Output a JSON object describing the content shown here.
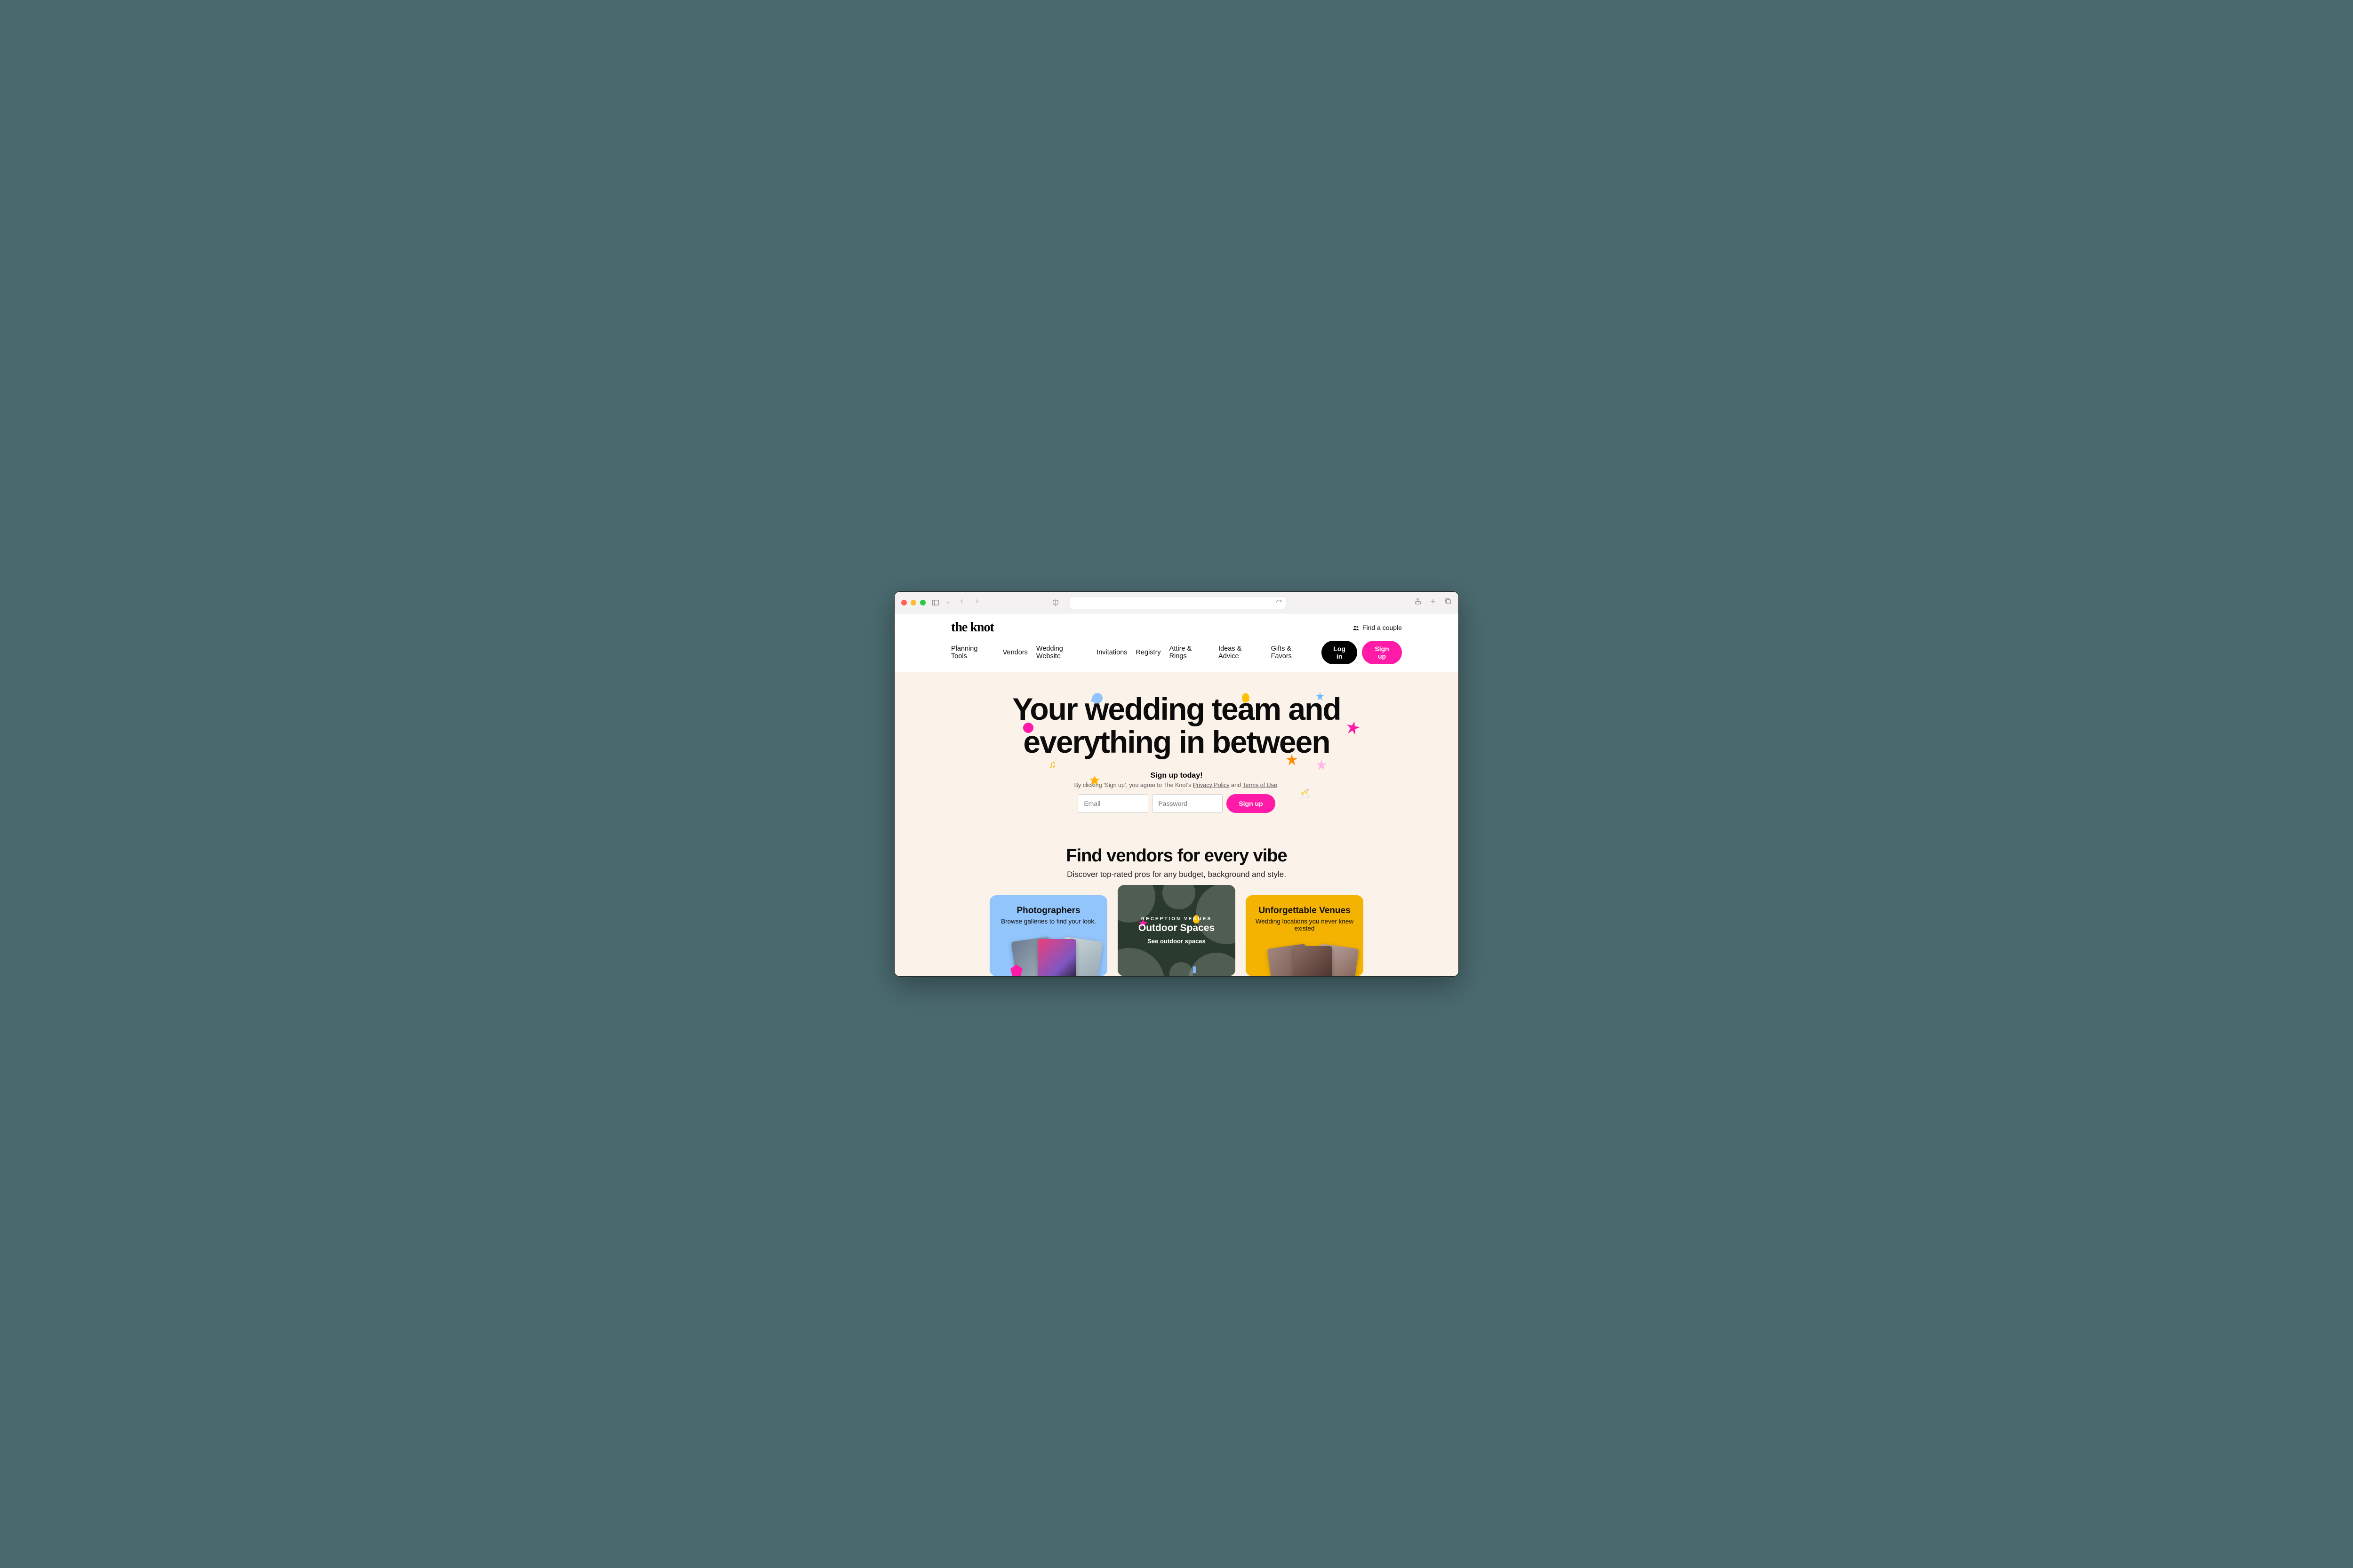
{
  "chrome": {
    "url": ""
  },
  "header": {
    "logo": "the knot",
    "find_couple": "Find a couple",
    "nav": [
      "Planning Tools",
      "Vendors",
      "Wedding Website",
      "Invitations",
      "Registry",
      "Attire & Rings",
      "Ideas & Advice",
      "Gifts & Favors"
    ],
    "login": "Log in",
    "signup": "Sign up"
  },
  "hero": {
    "title": "Your wedding team and everything in between",
    "signup_title": "Sign up today!",
    "legal_pre": "By clicking 'Sign up', you agree to The Knot's ",
    "privacy": "Privacy Policy",
    "legal_mid": " and ",
    "terms": "Terms of Use",
    "legal_post": ".",
    "email_ph": "Email",
    "password_ph": "Password",
    "signup_btn": "Sign up"
  },
  "vendors": {
    "title": "Find vendors for every vibe",
    "subtitle": "Discover top-rated pros for any budget, background and style.",
    "cards": {
      "photographers": {
        "title": "Photographers",
        "desc": "Browse galleries to find your look."
      },
      "outdoor": {
        "kicker": "RECEPTION VENUES",
        "title": "Outdoor Spaces",
        "link": "See outdoor spaces"
      },
      "venues": {
        "title": "Unforgettable Venues",
        "desc": "Wedding locations you never knew existed"
      }
    }
  }
}
